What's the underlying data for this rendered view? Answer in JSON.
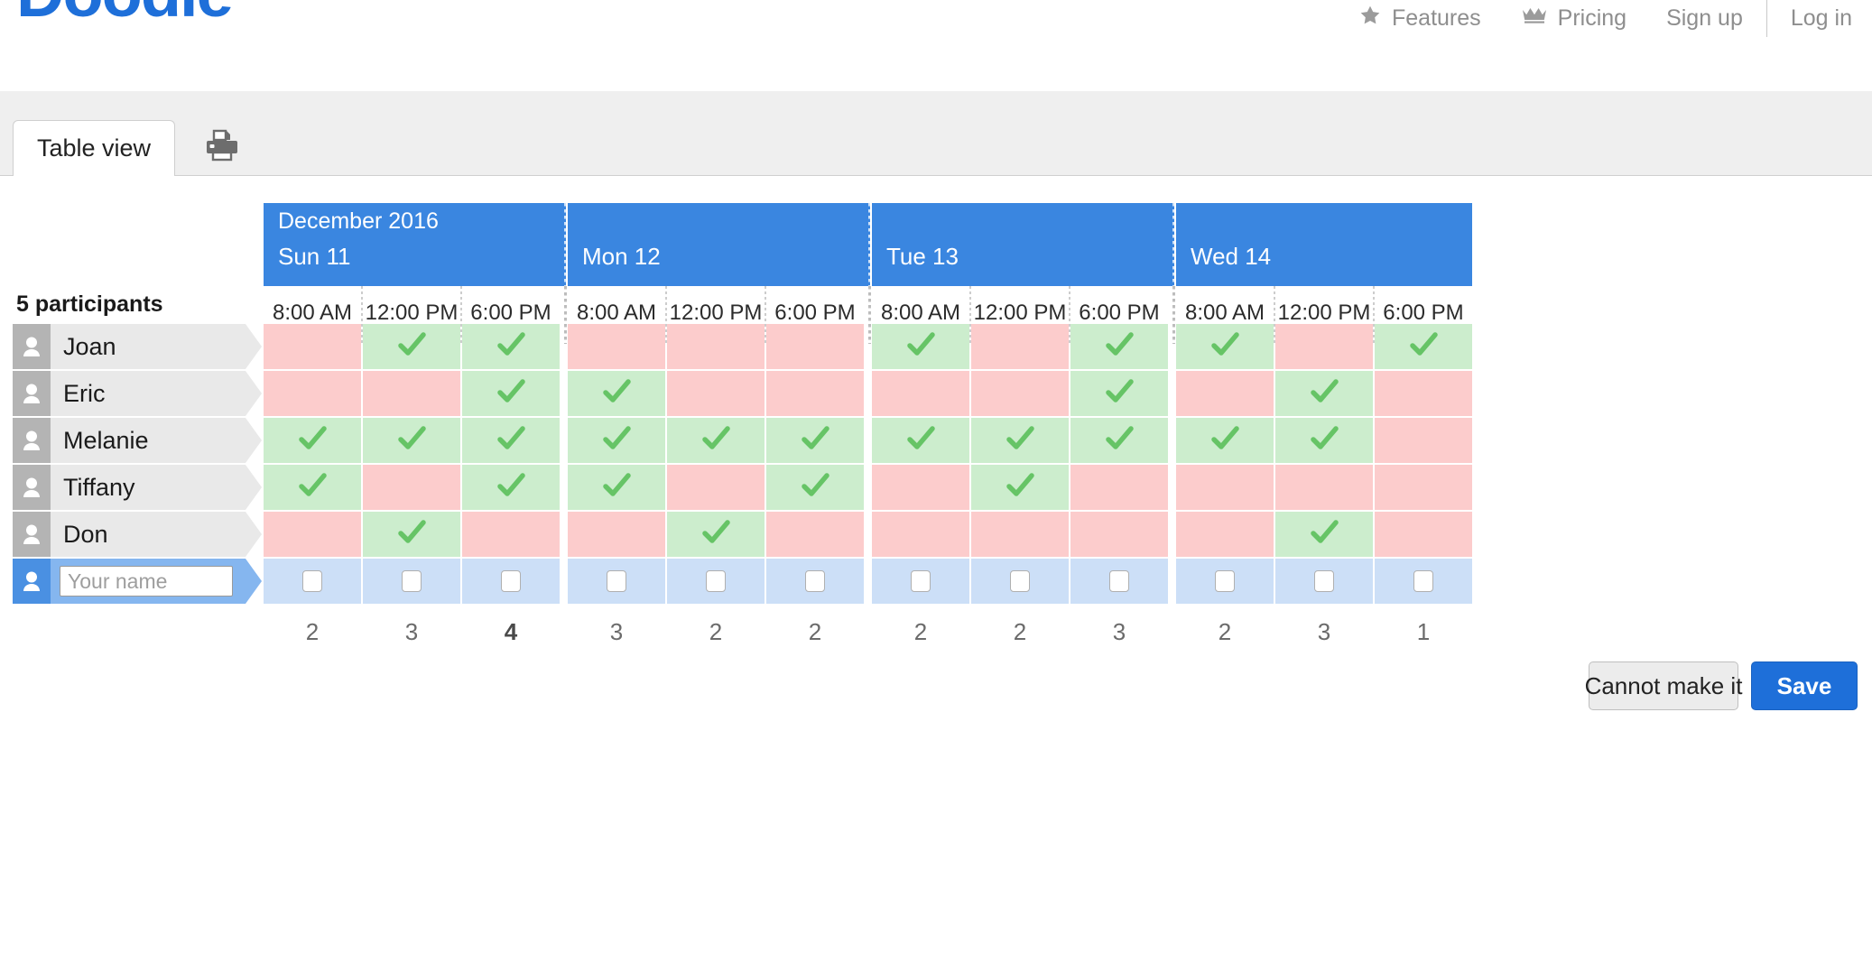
{
  "header": {
    "logo": "Doodle",
    "nav": [
      {
        "label": "Features",
        "icon": "star-icon"
      },
      {
        "label": "Pricing",
        "icon": "crown-icon"
      },
      {
        "label": "Sign up",
        "icon": null
      },
      {
        "label": "Log in",
        "icon": null
      }
    ]
  },
  "tabs": {
    "table_view": "Table view",
    "print_icon": "printer-icon"
  },
  "poll": {
    "participants_label": "5 participants",
    "month": "December 2016",
    "days": [
      {
        "label": "Sun 11",
        "times": [
          "8:00 AM",
          "12:00 PM",
          "6:00 PM"
        ]
      },
      {
        "label": "Mon 12",
        "times": [
          "8:00 AM",
          "12:00 PM",
          "6:00 PM"
        ]
      },
      {
        "label": "Tue 13",
        "times": [
          "8:00 AM",
          "12:00 PM",
          "6:00 PM"
        ]
      },
      {
        "label": "Wed 14",
        "times": [
          "8:00 AM",
          "12:00 PM",
          "6:00 PM"
        ]
      }
    ],
    "columns": [
      "Sun 11 8:00 AM",
      "Sun 11 12:00 PM",
      "Sun 11 6:00 PM",
      "Mon 12 8:00 AM",
      "Mon 12 12:00 PM",
      "Mon 12 6:00 PM",
      "Tue 13 8:00 AM",
      "Tue 13 12:00 PM",
      "Tue 13 6:00 PM",
      "Wed 14 8:00 AM",
      "Wed 14 12:00 PM",
      "Wed 14 6:00 PM"
    ],
    "participants": [
      {
        "name": "Joan",
        "votes": [
          0,
          1,
          1,
          0,
          0,
          0,
          1,
          0,
          1,
          1,
          0,
          1
        ]
      },
      {
        "name": "Eric",
        "votes": [
          0,
          0,
          1,
          1,
          0,
          0,
          0,
          0,
          1,
          0,
          1,
          0
        ]
      },
      {
        "name": "Melanie",
        "votes": [
          1,
          1,
          1,
          1,
          1,
          1,
          1,
          1,
          1,
          1,
          1,
          0
        ]
      },
      {
        "name": "Tiffany",
        "votes": [
          1,
          0,
          1,
          1,
          0,
          1,
          0,
          1,
          0,
          0,
          0,
          0
        ]
      },
      {
        "name": "Don",
        "votes": [
          0,
          1,
          0,
          0,
          1,
          0,
          0,
          0,
          0,
          0,
          1,
          0
        ]
      }
    ],
    "my_row": {
      "name_value": "",
      "name_placeholder": "Your name",
      "checkbox_count": 12
    },
    "totals": [
      2,
      3,
      4,
      3,
      2,
      2,
      2,
      2,
      3,
      2,
      3,
      1
    ],
    "best_total": 4
  },
  "actions": {
    "cannot_make_it": "Cannot make it",
    "save": "Save"
  },
  "colors": {
    "brand_blue": "#1e6fd9",
    "header_blue": "#3a86e0",
    "yes_green": "#ccedcd",
    "check_green": "#66c466",
    "no_pink": "#fccccc",
    "me_blue": "#ccdff7",
    "avatar_gray": "#b4b4b4",
    "name_gray": "#e9e9e9"
  }
}
